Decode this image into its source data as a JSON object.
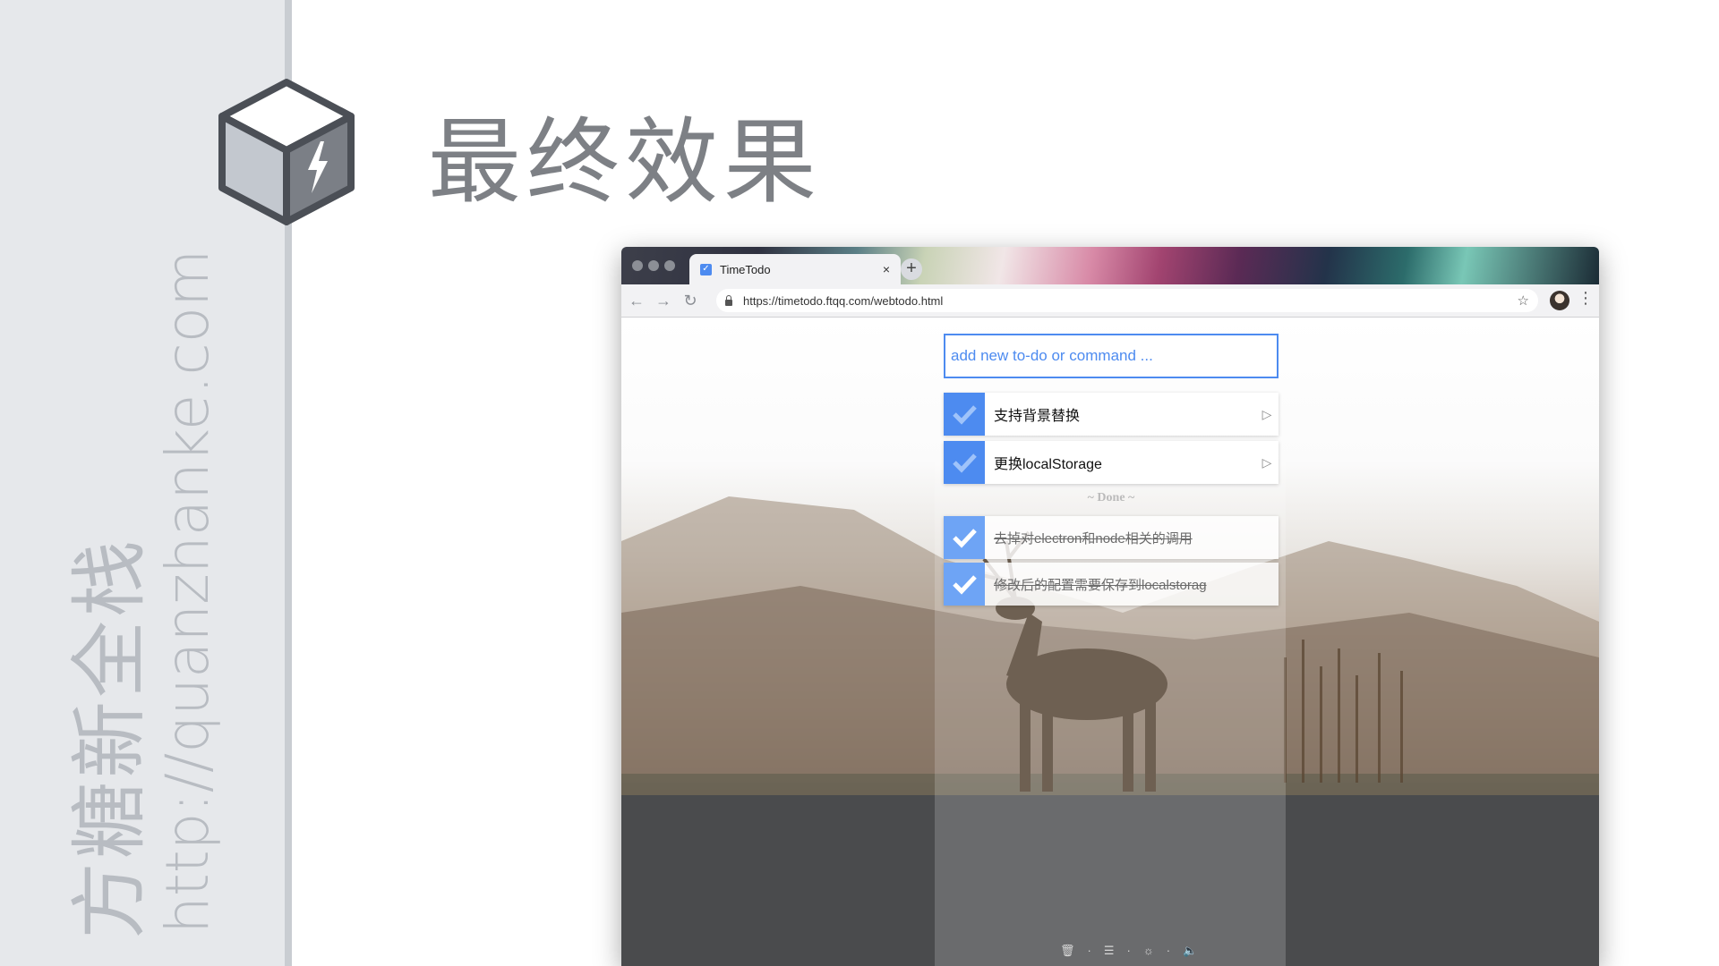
{
  "slide": {
    "title": "最终效果",
    "side_caption_cn": "方糖新全栈",
    "side_caption_url": "http://quanzhanke.com"
  },
  "browser": {
    "tab_title": "TimeTodo",
    "tab_close": "×",
    "new_tab": "+",
    "url": "https://timetodo.ftqq.com/webtodo.html",
    "nav": {
      "back": "←",
      "forward": "→",
      "reload": "↻"
    },
    "star": "☆",
    "menu": "⋮"
  },
  "app": {
    "input_placeholder": "add new to-do or command ...",
    "todos": [
      {
        "label": "支持背景替换"
      },
      {
        "label": "更换localStorage"
      }
    ],
    "done_label": "~ Done ~",
    "done": [
      {
        "label": "去掉对electron和node相关的调用"
      },
      {
        "label": "修改后的配置需要保存到localstorag"
      }
    ],
    "bottom_bar": {
      "trash": "🗑",
      "list": "☰",
      "theme": "☼",
      "sound": "🔈",
      "sep": "·"
    }
  },
  "colors": {
    "accent": "#4d8bf0",
    "sidebar": "#e6e8eb",
    "title": "#7d8085"
  },
  "icons": [
    "cube-logo-icon",
    "lock-icon",
    "star-icon",
    "check-icon",
    "play-icon",
    "trash-icon",
    "list-icon",
    "sun-icon",
    "speaker-icon"
  ]
}
